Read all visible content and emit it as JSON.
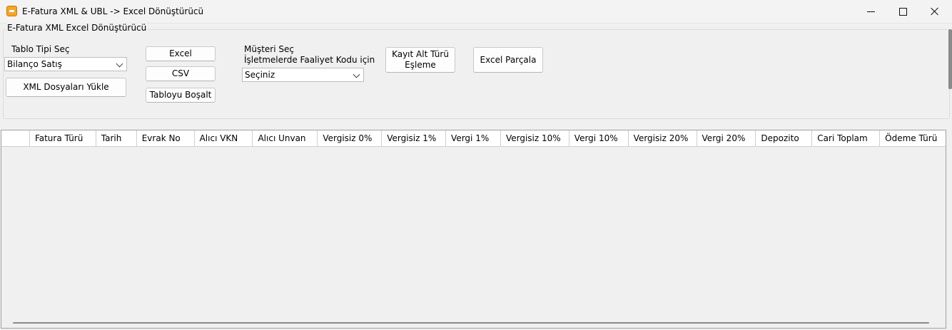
{
  "window": {
    "title": "E-Fatura XML & UBL -> Excel Dönüştürücü"
  },
  "group": {
    "title": "E-Fatura XML Excel Dönüştürücü"
  },
  "table_type": {
    "label": "Tablo Tipi Seç",
    "selected": "Bilanço Satış"
  },
  "buttons": {
    "load_xml": "XML Dosyaları Yükle",
    "excel": "Excel",
    "csv": "CSV",
    "clear_table": "Tabloyu Boşalt",
    "record_subtype_mapping": "Kayıt Alt Türü\nEşleme",
    "split_excel": "Excel Parçala"
  },
  "customer": {
    "label_line1": "Müşteri Seç",
    "label_line2": "İşletmelerde Faaliyet Kodu için",
    "selected": "Seçiniz"
  },
  "table": {
    "columns": [
      "Fatura Türü",
      "Tarih",
      "Evrak No",
      "Alıcı VKN",
      "Alıcı Unvan",
      "Vergisiz 0%",
      "Vergisiz 1%",
      "Vergi 1%",
      "Vergisiz 10%",
      "Vergi 10%",
      "Vergisiz 20%",
      "Vergi 20%",
      "Depozito",
      "Cari Toplam",
      "Ödeme Türü"
    ],
    "rows": []
  }
}
